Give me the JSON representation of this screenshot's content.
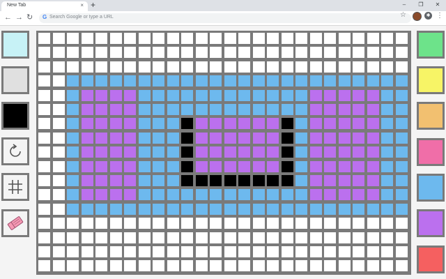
{
  "browser": {
    "tab_title": "New Tab",
    "tab_close": "×",
    "new_tab": "+",
    "window_controls": [
      "–",
      "❐",
      "✕"
    ],
    "nav_back": "←",
    "nav_forward": "→",
    "nav_reload": "↻",
    "omnibox_g": "G",
    "omnibox_placeholder": "Search Google or type a URL",
    "star": "☆",
    "menu": "⋮"
  },
  "tools": [
    {
      "name": "fill-light-cyan-tool",
      "color": "#c7f2f6"
    },
    {
      "name": "fill-light-gray-tool",
      "color": "#e0e0e0"
    },
    {
      "name": "fill-black-tool",
      "color": "#000000"
    },
    {
      "name": "reset-tool",
      "icon": "rotate-icon"
    },
    {
      "name": "grid-toggle-tool",
      "icon": "hash-grid-icon"
    },
    {
      "name": "eraser-tool",
      "icon": "eraser-icon"
    }
  ],
  "palette": [
    {
      "name": "green",
      "color": "#6de38a"
    },
    {
      "name": "yellow",
      "color": "#f7f466"
    },
    {
      "name": "orange",
      "color": "#f2c070"
    },
    {
      "name": "pink",
      "color": "#f06ea8"
    },
    {
      "name": "blue",
      "color": "#6db9ee"
    },
    {
      "name": "purple",
      "color": "#bb70ee"
    },
    {
      "name": "red",
      "color": "#f56060"
    }
  ],
  "canvas": {
    "columns": 26,
    "rows": 17,
    "colors": {
      "W": "#ffffff",
      "B": "#6db9ee",
      "P": "#bb70ee",
      "K": "#000000"
    },
    "cells": [
      "WWWWWWWWWWWWWWWWWWWWWWWWWW",
      "WWWWWWWWWWWWWWWWWWWWWWWWWW",
      "WWWWWWWWWWWWWWWWWWWWWWWWWW",
      "WWBBBBBBBBBBBBBBBBBBBBBBBB",
      "WWBPPPPBBBBBBBBBBBBPPPPPBB",
      "WWBPPPPBBBBBBBBBBBBPPPPPBB",
      "WWBPPPPBBBKPPPPPPKBPPPPPBB",
      "WWBPPPPBBBKPPPPPPKBPPPPPBB",
      "WWBPPPPBBBKPPPPPPKBPPPPPBB",
      "WWBPPPPBBBKPPPPPPKBPPPPPBB",
      "WWBPPPPBBBKKKKKKKKBPPPPPBB",
      "WWBPPPPBBBBBBBBBBBBPPPPPBB",
      "WWBBBBBBBBBBBBBBBBBBBBBBBB",
      "WWWWWWWWWWWWWWWWWWWWWWWWWW",
      "WWWWWWWWWWWWWWWWWWWWWWWWWW",
      "WWWWWWWWWWWWWWWWWWWWWWWWWW",
      "WWWWWWWWWWWWWWWWWWWWWWWWWW"
    ]
  }
}
